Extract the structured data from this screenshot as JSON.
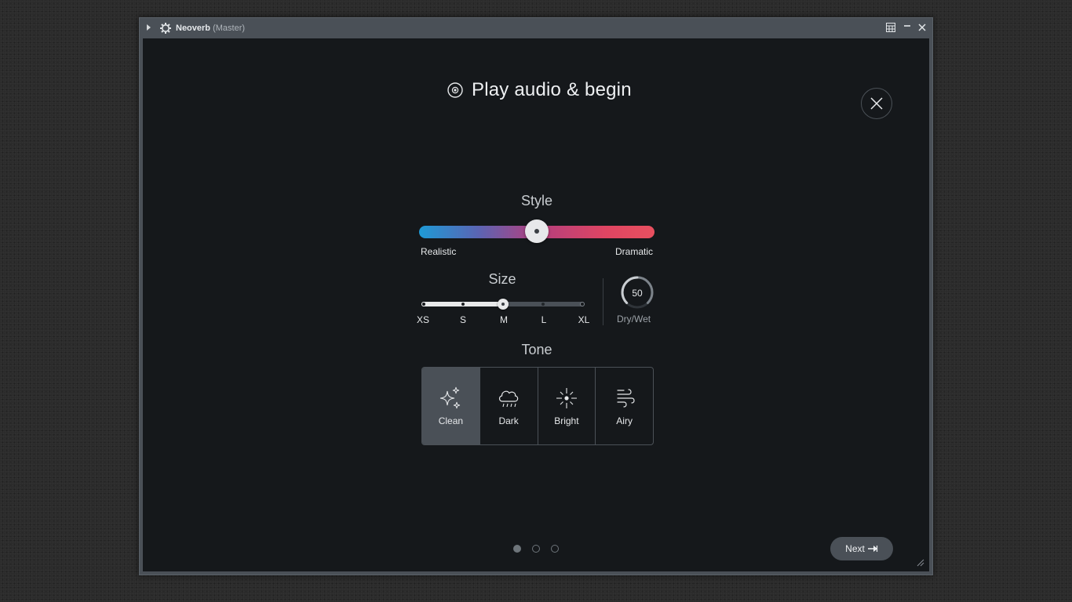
{
  "window": {
    "title": "Neoverb",
    "title_suffix": "(Master)"
  },
  "header": {
    "title": "Play audio & begin"
  },
  "style": {
    "label": "Style",
    "min_label": "Realistic",
    "max_label": "Dramatic",
    "value_fraction": 0.5
  },
  "size": {
    "label": "Size",
    "ticks": [
      "XS",
      "S",
      "M",
      "L",
      "XL"
    ],
    "selected": "M"
  },
  "drywet": {
    "value": "50",
    "label": "Dry/Wet"
  },
  "tone": {
    "label": "Tone",
    "options": [
      {
        "label": "Clean",
        "icon": "sparkle-icon",
        "active": true
      },
      {
        "label": "Dark",
        "icon": "rain-cloud-icon",
        "active": false
      },
      {
        "label": "Bright",
        "icon": "sun-icon",
        "active": false
      },
      {
        "label": "Airy",
        "icon": "wind-icon",
        "active": false
      }
    ]
  },
  "pager": {
    "pages": 3,
    "current": 1
  },
  "footer": {
    "next_label": "Next"
  },
  "colors": {
    "style_gradient_start": "#1e9ad6",
    "style_gradient_end": "#e8505f",
    "panel_bg": "#15181b",
    "accent_gray": "#4a5057"
  }
}
